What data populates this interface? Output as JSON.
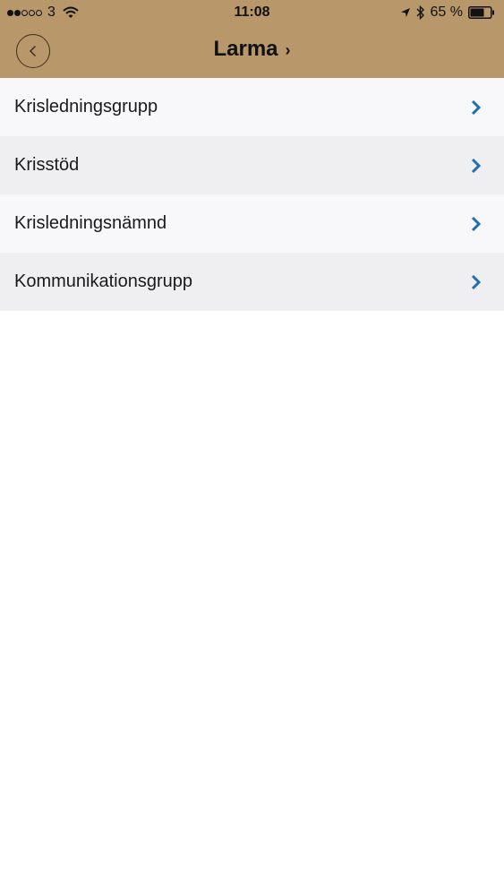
{
  "status_bar": {
    "carrier": "3",
    "time": "11:08",
    "battery": "65 %",
    "icons": [
      "signal-dots",
      "wifi-icon",
      "location-arrow-icon",
      "bluetooth-icon",
      "battery-icon"
    ]
  },
  "nav": {
    "title": "Larma",
    "title_chevron": "›",
    "back_icon": "chevron-left-icon"
  },
  "colors": {
    "header_background": "#b8976a",
    "chevron_accent": "#1f6fb5",
    "row_light": "#f8f8fa",
    "row_dark": "#efeff2"
  },
  "list": {
    "items": [
      {
        "label": "Krisledningsgrupp"
      },
      {
        "label": "Krisstöd"
      },
      {
        "label": "Krisledningsnämnd"
      },
      {
        "label": "Kommunikationsgrupp"
      }
    ]
  }
}
